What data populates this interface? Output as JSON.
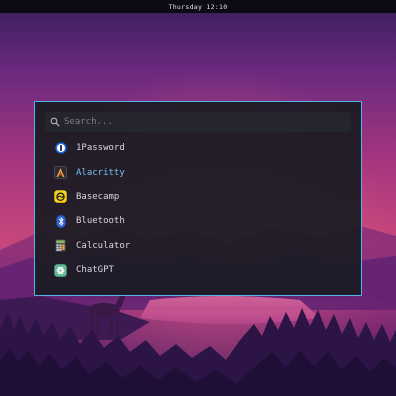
{
  "topbar": {
    "clock": "Thursday 12:10"
  },
  "launcher": {
    "search_placeholder": "Search...",
    "items": [
      {
        "label": "1Password",
        "icon": "1password-icon",
        "selected": false
      },
      {
        "label": "Alacritty",
        "icon": "alacritty-icon",
        "selected": true
      },
      {
        "label": "Basecamp",
        "icon": "basecamp-icon",
        "selected": false
      },
      {
        "label": "Bluetooth",
        "icon": "bluetooth-icon",
        "selected": false
      },
      {
        "label": "Calculator",
        "icon": "calculator-icon",
        "selected": false
      },
      {
        "label": "ChatGPT",
        "icon": "chatgpt-icon",
        "selected": false
      }
    ]
  },
  "colors": {
    "accent_border": "#4fb6e6",
    "selected_text": "#6fc3f0",
    "panel_bg": "#1c1c24"
  }
}
